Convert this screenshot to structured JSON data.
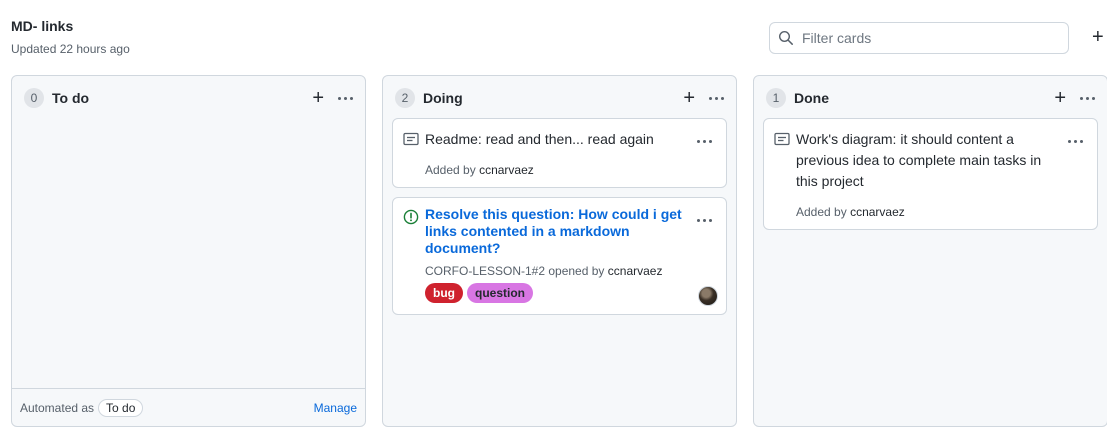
{
  "project": {
    "title": "MD- links",
    "updated": "Updated 22 hours ago"
  },
  "filter": {
    "placeholder": "Filter cards"
  },
  "add_column_label": "+",
  "columns": [
    {
      "count": "0",
      "name": "To do",
      "footer": {
        "automated_label": "Automated as",
        "automated_value": "To do",
        "manage_label": "Manage"
      }
    },
    {
      "count": "2",
      "name": "Doing",
      "cards": [
        {
          "text": "Readme: read and then... read again",
          "added_prefix": "Added by",
          "author": "ccnarvaez"
        },
        {
          "title": "Resolve this question: How could i get links contented in a markdown document?",
          "meta_prefix": "CORFO-LESSON-1#2 opened by",
          "author": "ccnarvaez",
          "labels": [
            {
              "name": "bug",
              "bg": "#cf222e",
              "fg": "#ffffff"
            },
            {
              "name": "question",
              "bg": "#d876e3",
              "fg": "#24292f"
            }
          ]
        }
      ]
    },
    {
      "count": "1",
      "name": "Done",
      "cards": [
        {
          "text": "Work's diagram: it should content a previous idea to complete main tasks in this project",
          "added_prefix": "Added by",
          "author": "ccnarvaez"
        }
      ]
    }
  ],
  "colors": {
    "accent": "#0969da",
    "issue_open": "#1a7f37",
    "column_bg": "#f6f8fa",
    "border": "#d0d7de"
  },
  "icons": {
    "search": "search-icon",
    "note": "note-icon",
    "issue": "issue-open-icon",
    "more": "kebab-icon",
    "plus": "plus-icon"
  }
}
